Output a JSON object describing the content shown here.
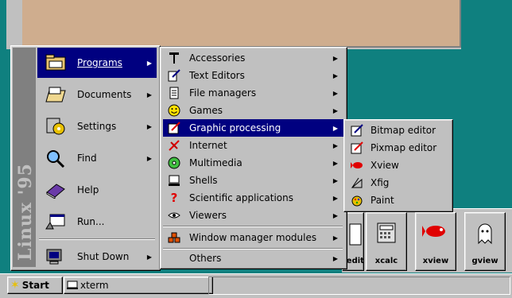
{
  "desktop": {
    "background_color": "#0f807f",
    "window_color": "#cfad8e"
  },
  "start_menu": {
    "banner": "Linux '95",
    "items": [
      {
        "label": "Programs",
        "icon": "programs-folder-icon",
        "has_submenu": true,
        "active": true
      },
      {
        "label": "Documents",
        "icon": "documents-folder-icon",
        "has_submenu": true
      },
      {
        "label": "Settings",
        "icon": "settings-icon",
        "has_submenu": true
      },
      {
        "label": "Find",
        "icon": "find-icon",
        "has_submenu": true
      },
      {
        "label": "Help",
        "icon": "help-book-icon",
        "has_submenu": false
      },
      {
        "label": "Run...",
        "icon": "run-icon",
        "has_submenu": false
      },
      {
        "label": "Shut Down",
        "icon": "shutdown-icon",
        "has_submenu": true
      }
    ]
  },
  "programs_menu": {
    "items": [
      {
        "label": "Accessories",
        "icon": "accessories-icon"
      },
      {
        "label": "Text Editors",
        "icon": "text-editor-icon"
      },
      {
        "label": "File managers",
        "icon": "file-manager-icon"
      },
      {
        "label": "Games",
        "icon": "games-smiley-icon"
      },
      {
        "label": "Graphic processing",
        "icon": "graphics-icon",
        "active": true
      },
      {
        "label": "Internet",
        "icon": "internet-icon"
      },
      {
        "label": "Multimedia",
        "icon": "multimedia-icon"
      },
      {
        "label": "Shells",
        "icon": "shells-icon"
      },
      {
        "label": "Scientific applications",
        "icon": "science-icon"
      },
      {
        "label": "Viewers",
        "icon": "viewers-eye-icon"
      },
      {
        "label": "Window manager modules",
        "icon": "wm-modules-icon"
      },
      {
        "label": "Others",
        "icon": ""
      }
    ]
  },
  "graphic_menu": {
    "items": [
      {
        "label": "Bitmap editor",
        "icon": "bitmap-editor-icon"
      },
      {
        "label": "Pixmap editor",
        "icon": "pixmap-editor-icon"
      },
      {
        "label": "Xview",
        "icon": "xview-fish-icon"
      },
      {
        "label": "Xfig",
        "icon": "xfig-icon"
      },
      {
        "label": "Paint",
        "icon": "paint-icon"
      }
    ]
  },
  "toolbar": {
    "apps": [
      {
        "label": "tedit"
      },
      {
        "label": "xcalc"
      },
      {
        "label": "xview"
      },
      {
        "label": "gview"
      }
    ]
  },
  "taskbar": {
    "start_label": "Start",
    "tasks": [
      {
        "label": "xterm"
      }
    ]
  }
}
